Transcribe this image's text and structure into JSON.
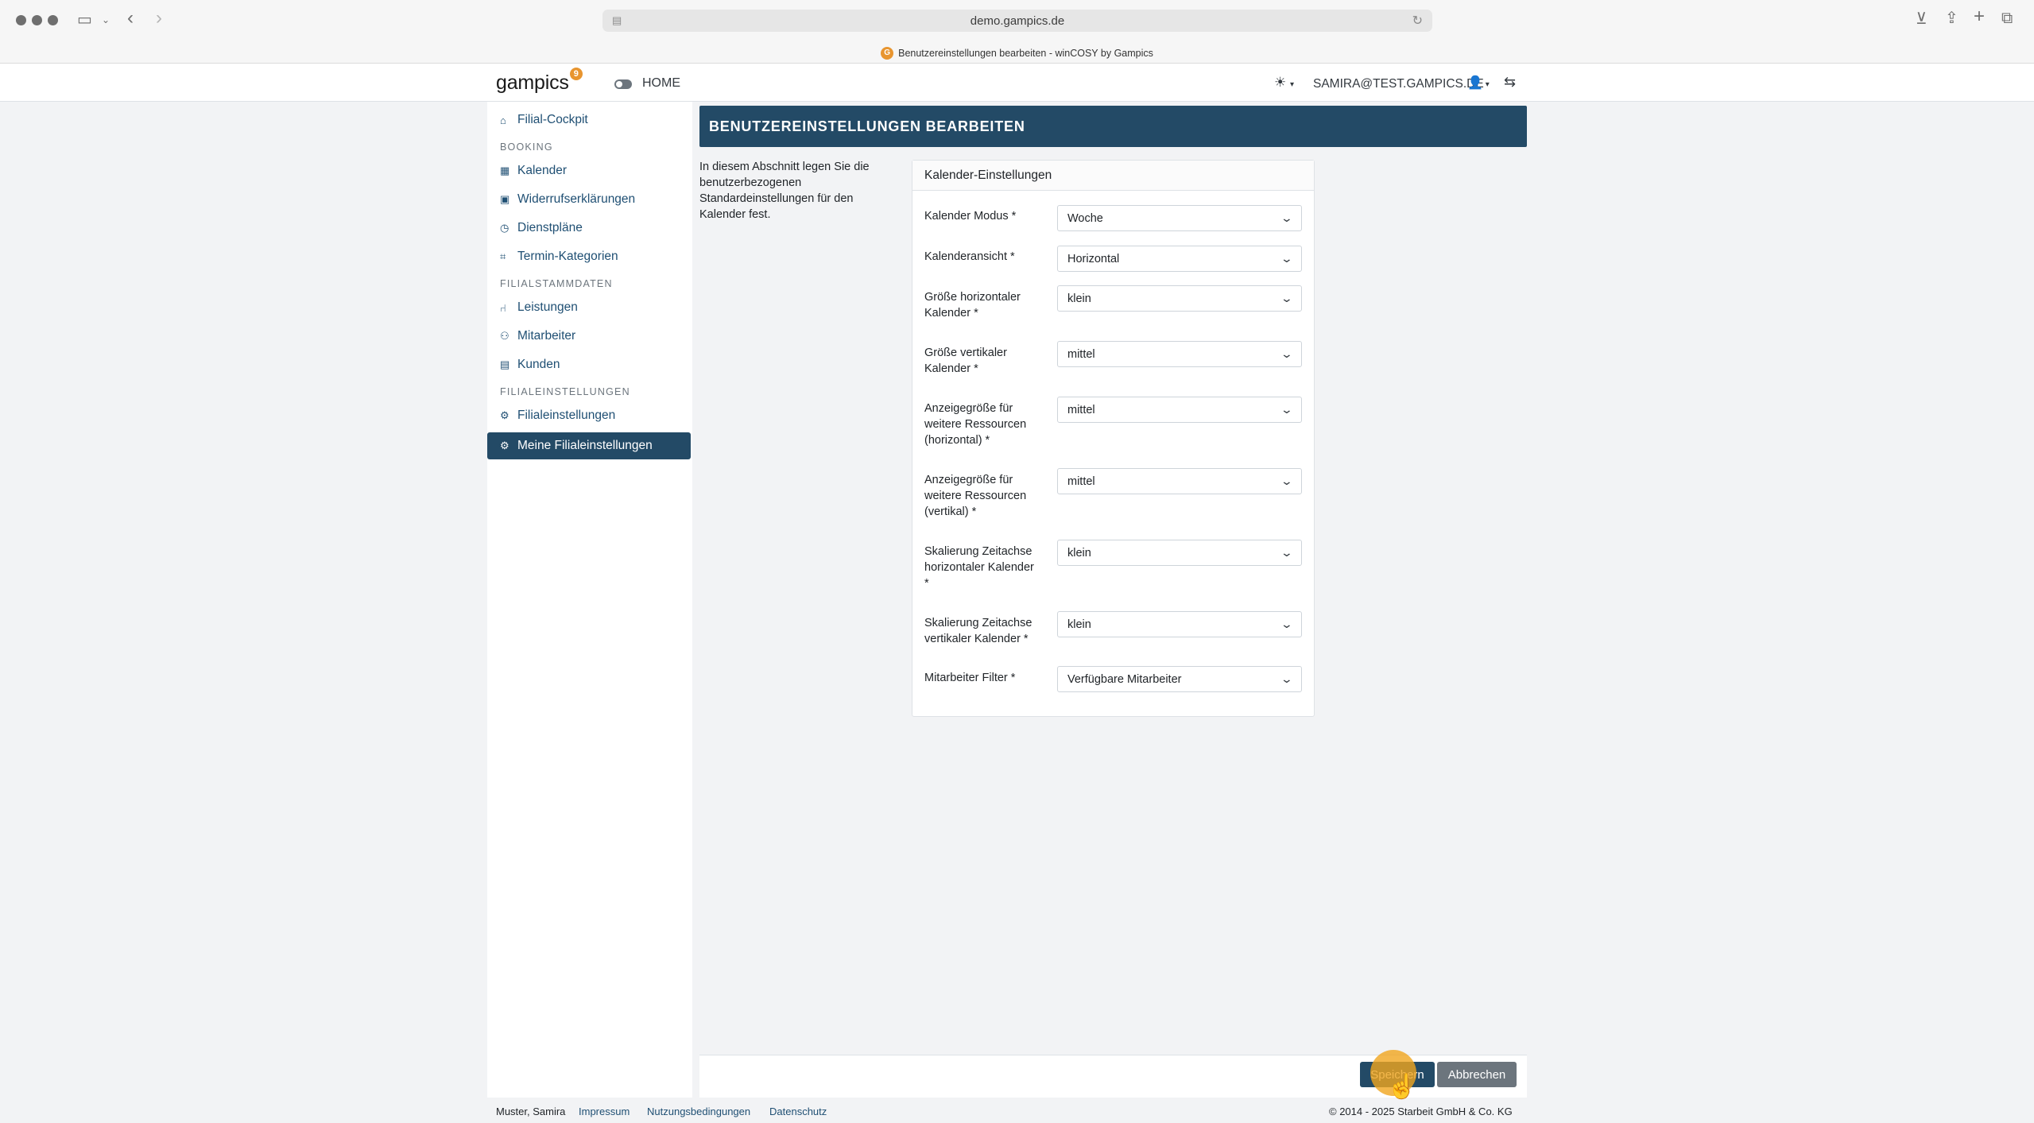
{
  "browser": {
    "url": "demo.gampics.de",
    "tab_title": "Benutzereinstellungen bearbeiten - winCOSY by Gampics",
    "tab_favicon_text": "G"
  },
  "header": {
    "logo": "gampics",
    "logo_badge": "9",
    "home_label": "HOME",
    "user_email": "SAMIRA@TEST.GAMPICS.DE"
  },
  "sidebar": {
    "cockpit": "Filial-Cockpit",
    "section_booking": "BOOKING",
    "kalender": "Kalender",
    "widerruf": "Widerrufserklärungen",
    "dienstplaene": "Dienstpläne",
    "termin_kategorien": "Termin-Kategorien",
    "section_stammdaten": "FILIALSTAMMDATEN",
    "leistungen": "Leistungen",
    "mitarbeiter": "Mitarbeiter",
    "kunden": "Kunden",
    "section_einstellungen": "FILIALEINSTELLUNGEN",
    "filialeinstellungen": "Filialeinstellungen",
    "meine_filialeinstellungen": "Meine Filialeinstellungen"
  },
  "main": {
    "title": "BENUTZEREINSTELLUNGEN BEARBEITEN",
    "description": "In diesem Abschnitt legen Sie die benutzerbezogenen Standardeinstellungen für den Kalender fest.",
    "card_title": "Kalender-Einstellungen",
    "fields": [
      {
        "label": "Kalender Modus *",
        "value": "Woche"
      },
      {
        "label": "Kalenderansicht *",
        "value": "Horizontal"
      },
      {
        "label": "Größe horizontaler Kalender *",
        "value": "klein"
      },
      {
        "label": "Größe vertikaler Kalender *",
        "value": "mittel"
      },
      {
        "label": "Anzeigegröße für weitere Ressourcen (horizontal) *",
        "value": "mittel"
      },
      {
        "label": "Anzeigegröße für weitere Ressourcen (vertikal) *",
        "value": "mittel"
      },
      {
        "label": "Skalierung Zeitachse horizontaler Kalender *",
        "value": "klein"
      },
      {
        "label": "Skalierung Zeitachse vertikaler Kalender *",
        "value": "klein"
      },
      {
        "label": "Mitarbeiter Filter *",
        "value": "Verfügbare Mitarbeiter"
      }
    ]
  },
  "actions": {
    "save": "Speichern",
    "cancel": "Abbrechen"
  },
  "footer": {
    "user": "Muster, Samira",
    "impressum": "Impressum",
    "nutzungsbedingungen": "Nutzungsbedingungen",
    "datenschutz": "Datenschutz",
    "copyright": "© 2014 - 2025 Starbeit GmbH & Co. KG"
  },
  "colors": {
    "primary": "#234a66",
    "accent": "#e8952f",
    "secondary": "#6c757d"
  }
}
